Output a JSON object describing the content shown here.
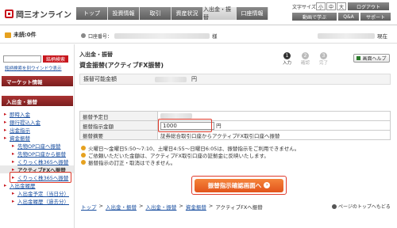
{
  "header": {
    "logo_text": "岡三オンライン",
    "nav": [
      "トップ",
      "投資情報",
      "取引",
      "資産状況",
      "入出金・振替",
      "口座情報"
    ],
    "active_nav_index": 4,
    "font_size_label": "文字サイズ",
    "font_sizes": [
      "小",
      "中",
      "大"
    ],
    "logout": "ログアウト",
    "util_buttons": [
      "動画で学ぶ",
      "Q&A",
      "サポート"
    ]
  },
  "subbar": {
    "unread": "未読:0件",
    "account_label": "口座番号：",
    "account_suffix": "様",
    "timestamp_suffix": "現在"
  },
  "sidebar": {
    "search_button": "銘柄検索",
    "search_window_link": "銘柄検索を別ウインドウ表示",
    "market_info": "マーケット情報",
    "section_title": "入出金・振替",
    "items": [
      {
        "label": "即時入金",
        "level": 1
      },
      {
        "label": "銀行提込入金",
        "level": 1
      },
      {
        "label": "出金指示",
        "level": 1
      },
      {
        "label": "資金振替",
        "level": 1
      },
      {
        "label": "先物OP口座へ振替",
        "level": 2
      },
      {
        "label": "先物OP口座から振替",
        "level": 2
      },
      {
        "label": "くりっく株365へ振替",
        "level": 2
      },
      {
        "label": "アクティブFXへ振替",
        "level": 2,
        "active": true
      },
      {
        "label": "くりっく株365へ振替",
        "level": 2
      },
      {
        "label": "入出金履歴",
        "level": 1
      },
      {
        "label": "入出金予定（当日分）",
        "level": 2
      },
      {
        "label": "入出金履歴（過去分）",
        "level": 2
      }
    ]
  },
  "main": {
    "breadcrumb_top": "入出金・振替",
    "page_title": "資金振替(アクティブFX振替)",
    "steps": [
      "入力",
      "確認",
      "完了"
    ],
    "active_step": 1,
    "help_button": "画面ヘルプ",
    "available_label": "振替可能金額",
    "available_unit": "円",
    "rows": [
      {
        "label": "振替予定日",
        "value": ""
      },
      {
        "label": "振替指示金額",
        "value": "1000",
        "unit": "円"
      },
      {
        "label": "振替摘要",
        "value": "証券総合取引口座からアクティブFX取引口座へ振替"
      }
    ],
    "notes": [
      "火曜日～金曜日5:50～7:10、土曜日4:55～日曜日6:05は、振替指示をご利用できません。",
      "ご依頼いただいた金額は、アクティブFX取引口座の証拠金に反映いたします。",
      "振替指示の訂正・取消はできません。"
    ],
    "confirm_button": "振替指示確認画面へ",
    "breadcrumb": [
      "トップ",
      "入出金・振替",
      "入出金・振替",
      "資金振替",
      "アクティブFXへ振替"
    ],
    "page_top": "ページのトップへもどる"
  }
}
